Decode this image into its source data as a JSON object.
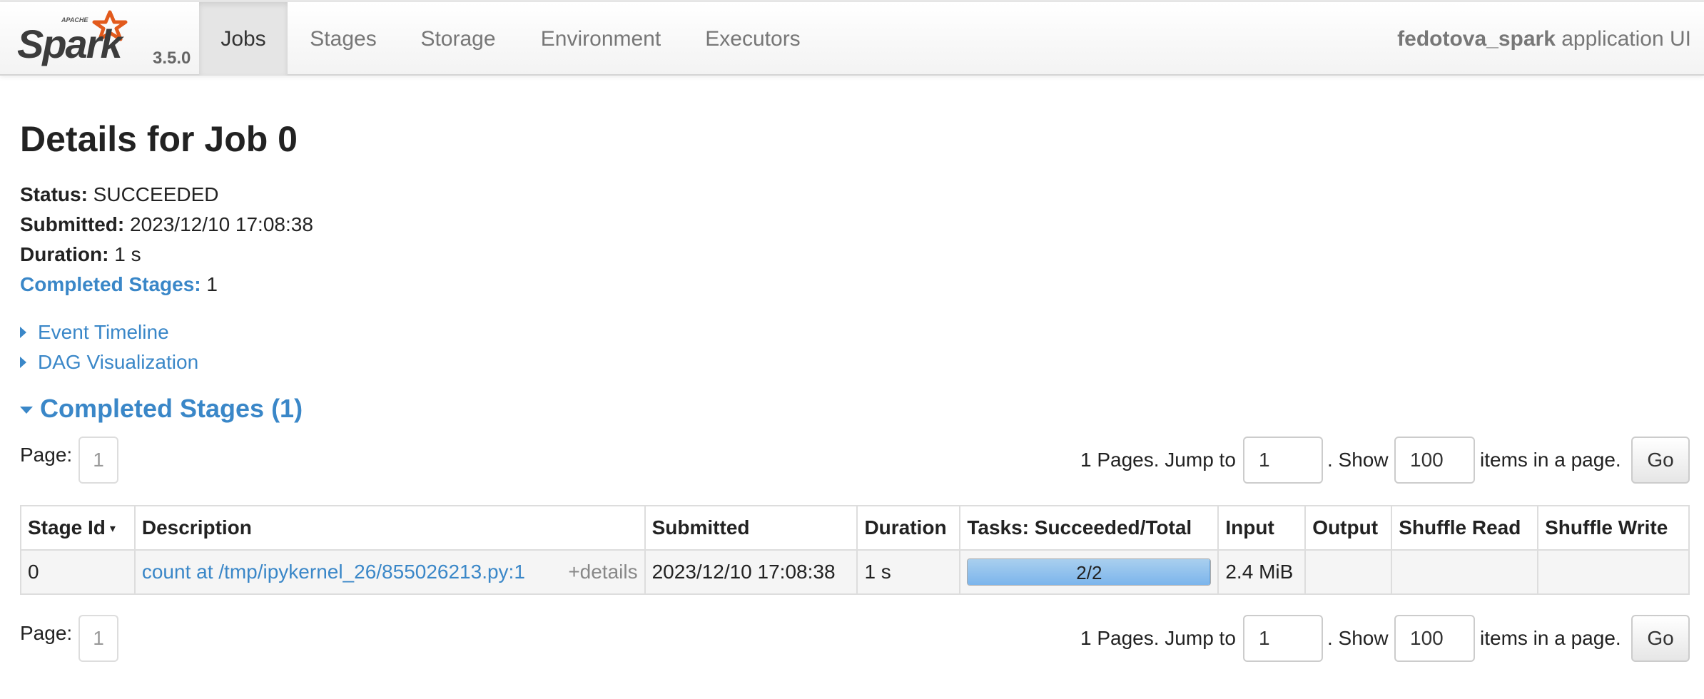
{
  "navbar": {
    "logo_text": "Spark",
    "logo_small_text": "APACHE",
    "version": "3.5.0",
    "tabs": [
      {
        "label": "Jobs",
        "active": true
      },
      {
        "label": "Stages",
        "active": false
      },
      {
        "label": "Storage",
        "active": false
      },
      {
        "label": "Environment",
        "active": false
      },
      {
        "label": "Executors",
        "active": false
      }
    ],
    "app_name": "fedotova_spark",
    "app_suffix": " application UI"
  },
  "page": {
    "title": "Details for Job 0",
    "summary": {
      "status_label": "Status:",
      "status_value": " SUCCEEDED",
      "submitted_label": "Submitted:",
      "submitted_value": " 2023/12/10 17:08:38",
      "duration_label": "Duration:",
      "duration_value": " 1 s",
      "completed_label": "Completed Stages:",
      "completed_value": " 1"
    },
    "event_timeline": "Event Timeline",
    "dag_visualization": "DAG Visualization",
    "section_title": "Completed Stages (1)"
  },
  "pagination": {
    "page_label": "Page:",
    "current_page": "1",
    "pages_text": "1 Pages. Jump to",
    "jump_value": "1",
    "show_text": ". Show",
    "show_value": "100",
    "items_text": "items in a page.",
    "go_label": "Go"
  },
  "table": {
    "columns": [
      "Stage Id",
      "Description",
      "Submitted",
      "Duration",
      "Tasks: Succeeded/Total",
      "Input",
      "Output",
      "Shuffle Read",
      "Shuffle Write"
    ],
    "sort_indicator": "▾",
    "rows": [
      {
        "stage_id": "0",
        "description": "count at /tmp/ipykernel_26/855026213.py:1",
        "details": "+details",
        "submitted": "2023/12/10 17:08:38",
        "duration": "1 s",
        "tasks": "2/2",
        "tasks_fraction": 1.0,
        "input": "2.4 MiB",
        "output": "",
        "shuffle_read": "",
        "shuffle_write": ""
      }
    ]
  },
  "colors": {
    "link": "#3a87c8",
    "progress": "#7cb5ec",
    "spark_orange": "#e25a1c"
  }
}
